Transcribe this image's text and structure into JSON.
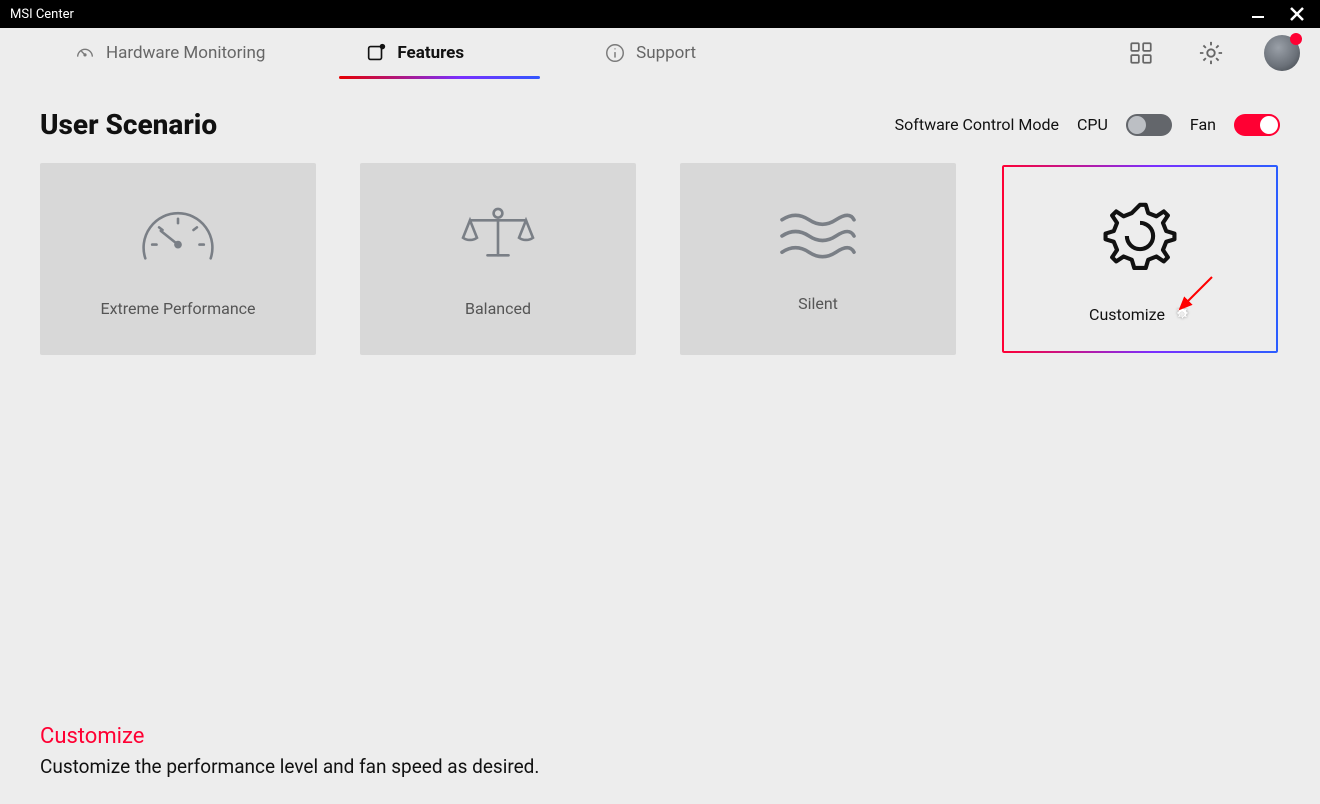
{
  "window": {
    "title": "MSI Center"
  },
  "tabs": {
    "hardware": "Hardware Monitoring",
    "features": "Features",
    "support": "Support"
  },
  "section": {
    "title": "User Scenario",
    "control_label": "Software Control Mode",
    "cpu_label": "CPU",
    "fan_label": "Fan"
  },
  "cards": {
    "extreme": "Extreme Performance",
    "balanced": "Balanced",
    "silent": "Silent",
    "customize": "Customize"
  },
  "footer": {
    "title": "Customize",
    "desc": "Customize the performance level and fan speed as desired."
  }
}
